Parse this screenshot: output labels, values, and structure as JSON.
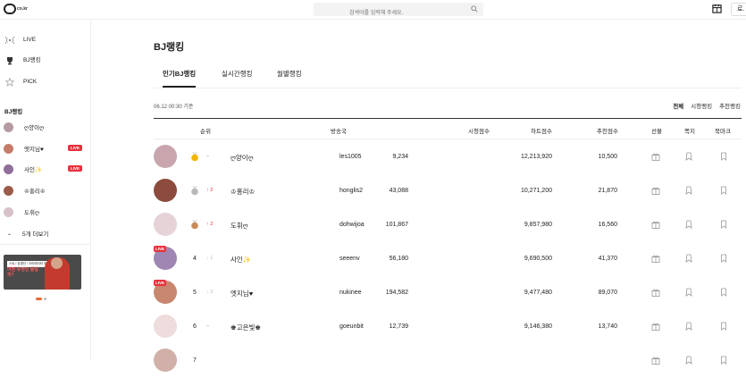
{
  "header": {
    "logo_text": "co.kr",
    "search_placeholder": "검색어를 입력해 주세요.",
    "login_label": "로."
  },
  "sidebar": {
    "nav": [
      {
        "label": "LIVE",
        "icon": "live-icon"
      },
      {
        "label": "BJ랭킹",
        "icon": "trophy-icon"
      },
      {
        "label": "PICK",
        "icon": "star-icon"
      }
    ],
    "section_title": "BJ랭킹",
    "bjs": [
      {
        "name": "ღ양이ღ",
        "live": false,
        "color": "#b79aa0"
      },
      {
        "name": "엣지님♥",
        "live": true,
        "color": "#c77c6a"
      },
      {
        "name": "사인✨",
        "live": true,
        "color": "#8f6f9a"
      },
      {
        "name": "♔홍리♔",
        "live": false,
        "color": "#9b5a4a"
      },
      {
        "name": "도휘ღ",
        "live": false,
        "color": "#d8c2c8"
      }
    ],
    "live_badge": "LIVE",
    "more_label": "5개 더보기",
    "banner": {
      "tag": "스트 / 유명인 / 크리에이터 최적화",
      "headline": "어떤 유명인 들일까?"
    }
  },
  "main": {
    "title": "BJ랭킹",
    "tabs": [
      {
        "label": "인기BJ랭킹",
        "active": true
      },
      {
        "label": "실시간랭킹",
        "active": false
      },
      {
        "label": "월별랭킹",
        "active": false
      }
    ],
    "timestamp": "06.12 00:30 기준",
    "filters": [
      {
        "label": "전체",
        "active": true
      },
      {
        "label": "시청랭킹",
        "active": false
      },
      {
        "label": "추천랭킹",
        "active": false
      }
    ],
    "columns": {
      "rank": "순위",
      "station": "방송국",
      "view": "시청점수",
      "heart": "하트점수",
      "recommend": "추천점수",
      "gift": "선물",
      "letter": "쪽지",
      "bookmark": "북마크"
    },
    "rows": [
      {
        "rank": "1",
        "medal": "gold",
        "change_dir": "same",
        "change": "–",
        "nick": "ღ양이ღ",
        "id": "les1005",
        "view": "9,234",
        "heart": "12,213,920",
        "recommend": "10,500",
        "live": false,
        "color": "#c9a6ae"
      },
      {
        "rank": "2",
        "medal": "silver",
        "change_dir": "up",
        "change": "2",
        "nick": "♔홍리♔",
        "id": "honglis2",
        "view": "43,088",
        "heart": "10,271,200",
        "recommend": "21,870",
        "live": false,
        "color": "#8c4b3c"
      },
      {
        "rank": "3",
        "medal": "bronze",
        "change_dir": "up",
        "change": "2",
        "nick": "도휘ღ",
        "id": "dohwijoa",
        "view": "101,867",
        "heart": "9,857,980",
        "recommend": "16,560",
        "live": false,
        "color": "#e6d3d8"
      },
      {
        "rank": "4",
        "medal": "",
        "change_dir": "down",
        "change": "1",
        "nick": "사인✨",
        "id": "seeenv",
        "view": "56,180",
        "heart": "9,690,500",
        "recommend": "41,370",
        "live": true,
        "color": "#9f86b3"
      },
      {
        "rank": "5",
        "medal": "",
        "change_dir": "down",
        "change": "3",
        "nick": "엣지님♥",
        "id": "nukinee",
        "view": "194,582",
        "heart": "9,477,480",
        "recommend": "89,070",
        "live": true,
        "color": "#c9876f"
      },
      {
        "rank": "6",
        "medal": "",
        "change_dir": "same",
        "change": "–",
        "nick": "♚고은빛♚",
        "id": "goeunbit",
        "view": "12,739",
        "heart": "9,146,380",
        "recommend": "13,740",
        "live": false,
        "color": "#efdcdc"
      },
      {
        "rank": "7",
        "medal": "",
        "change_dir": "same",
        "change": "",
        "nick": "",
        "id": "",
        "view": "",
        "heart": "",
        "recommend": "",
        "live": false,
        "color": "#d0b0a8"
      }
    ],
    "live_badge": "LIVE"
  },
  "colors": {
    "accent": "#e8303c",
    "gold": "#f2b600",
    "silver": "#b9b9b9",
    "bronze": "#c98b5a"
  }
}
